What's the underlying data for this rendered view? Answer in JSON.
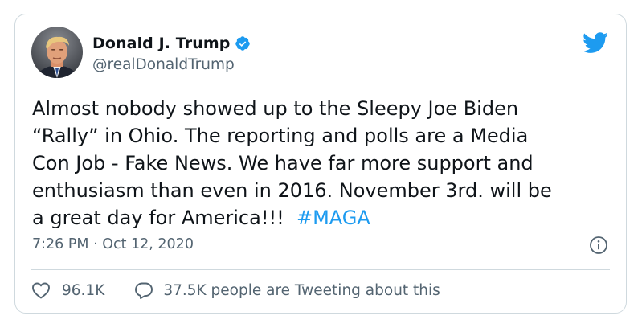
{
  "tweet": {
    "author": {
      "name": "Donald J. Trump",
      "handle": "@realDonaldTrump",
      "verified": true
    },
    "text": "Almost nobody showed up to the Sleepy Joe Biden\n“Rally” in Ohio. The reporting and polls are a Media\nCon Job - Fake News. We have far more support and\nenthusiasm than even in 2016. November 3rd. will be\na great day for America!!!  ",
    "hashtag": "#MAGA",
    "timestamp": "7:26 PM · Oct 12, 2020",
    "likes": "96.1K",
    "tweeting": "37.5K people are Tweeting about this"
  },
  "colors": {
    "link": "#1d9bf0",
    "secondary_text": "#536471",
    "border": "#cfd9de",
    "verified_badge": "#1d9bf0",
    "twitter_logo": "#1d9bf0"
  },
  "icons": {
    "verified": "verified-badge-icon",
    "logo": "twitter-bird-icon",
    "info": "info-icon",
    "like": "heart-icon",
    "reply": "reply-bubble-icon"
  }
}
